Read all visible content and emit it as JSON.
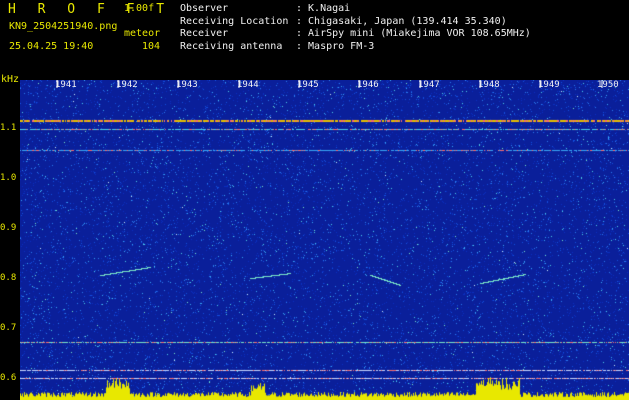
{
  "header": {
    "brand": "H R O F F T",
    "version": "1.00f",
    "filename": "KN9_2504251940.png",
    "mode": "meteor",
    "timestamp": "25.04.25 19:40",
    "counter": "104",
    "fields": [
      {
        "key": "Observer",
        "value": ": K.Nagai"
      },
      {
        "key": "Receiving Location",
        "value": ": Chigasaki, Japan (139.414 35.340)"
      },
      {
        "key": "Receiver",
        "value": ": AirSpy mini (Miakejima VOR 108.65MHz)"
      },
      {
        "key": "Receiving antenna",
        "value": ": Maspro FM-3"
      }
    ]
  },
  "spectrogram": {
    "unit": "kHz",
    "y_ticks": [
      "1.1",
      "1.0",
      "0.9",
      "0.8",
      "0.7",
      "0.6"
    ],
    "x_ticks": [
      "1941",
      "1942",
      "1943",
      "1944",
      "1945",
      "1946",
      "1947",
      "1948",
      "1949",
      "1950"
    ],
    "colors": {
      "background": "#0a1f9a",
      "carrier": "#e8e800",
      "text": "#e8e800"
    }
  }
}
